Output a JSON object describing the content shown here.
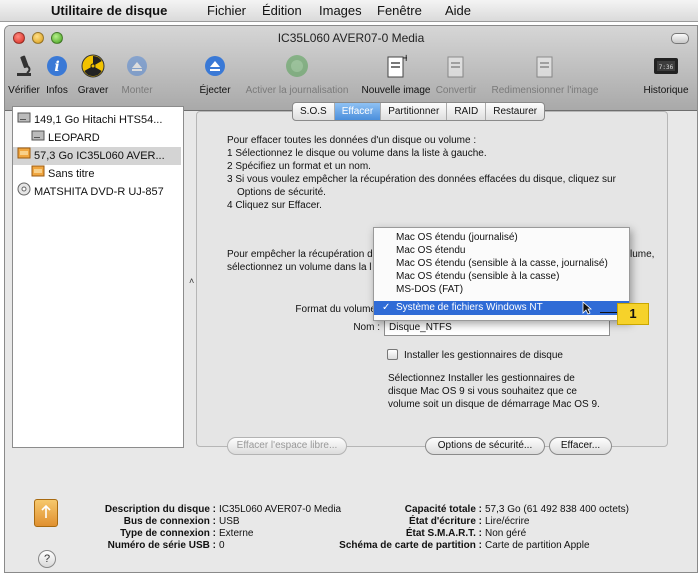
{
  "menubar": {
    "app_name": "Utilitaire de disque",
    "items": [
      "Fichier",
      "Édition",
      "Images",
      "Fenêtre",
      "Aide"
    ]
  },
  "window": {
    "title": "IC35L060 AVER07-0 Media"
  },
  "toolbar": {
    "items": [
      {
        "label": "Vérifier",
        "icon": "microscope-icon",
        "enabled": true
      },
      {
        "label": "Infos",
        "icon": "info-icon",
        "enabled": true
      },
      {
        "label": "Graver",
        "icon": "burn-icon",
        "enabled": true
      },
      {
        "label": "Monter",
        "icon": "mount-icon",
        "enabled": false
      },
      {
        "label": "Éjecter",
        "icon": "eject-icon",
        "enabled": true
      },
      {
        "label": "Activer la journalisation",
        "icon": "journal-icon",
        "enabled": false
      },
      {
        "label": "Nouvelle image",
        "icon": "new-image-icon",
        "enabled": true
      },
      {
        "label": "Convertir",
        "icon": "convert-icon",
        "enabled": false
      },
      {
        "label": "Redimensionner l'image",
        "icon": "resize-icon",
        "enabled": false
      },
      {
        "label": "Historique",
        "icon": "log-icon",
        "enabled": true
      }
    ]
  },
  "sidebar": {
    "items": [
      {
        "label": "149,1 Go Hitachi HTS54...",
        "icon": "hard-disk-icon",
        "selected": false
      },
      {
        "label": "LEOPARD",
        "icon": "volume-icon",
        "selected": false
      },
      {
        "label": "57,3 Go IC35L060 AVER...",
        "icon": "external-disk-icon",
        "selected": true
      },
      {
        "label": "Sans titre",
        "icon": "external-volume-icon",
        "selected": false
      },
      {
        "label": "MATSHITA DVD-R UJ-857",
        "icon": "optical-drive-icon",
        "selected": false
      }
    ]
  },
  "tabs": [
    "S.O.S",
    "Effacer",
    "Partitionner",
    "RAID",
    "Restaurer"
  ],
  "active_tab": "Effacer",
  "erase": {
    "instructions": [
      "Pour effacer toutes les données d'un disque ou volume :",
      "1 Sélectionnez le disque ou volume dans la liste à gauche.",
      "2 Spécifiez un format et un nom.",
      "3 Si vous voulez empêcher la récupération des données effacées du disque, cliquez sur",
      "Options de sécurité.",
      "4 Cliquez sur Effacer."
    ],
    "para2_line1_start": "Pour empêcher la récupération d",
    "para2_line1_end": "lume,",
    "para2_line2_start": "sélectionnez un volume dans la l",
    "format_label": "Format du volume",
    "name_label": "Nom :",
    "name_value": "Disque_NTFS",
    "install_drivers_label": "Installer les gestionnaires de disque",
    "drivers_help": [
      "Sélectionnez Installer les gestionnaires de",
      "disque Mac OS 9 si vous souhaitez que ce",
      "volume soit un disque de démarrage Mac OS 9."
    ],
    "erase_free_space_button": "Effacer l'espace libre...",
    "security_options_button": "Options de sécurité...",
    "erase_button": "Effacer..."
  },
  "format_menu": {
    "options": [
      "Mac OS étendu (journalisé)",
      "Mac OS étendu",
      "Mac OS étendu (sensible à la casse, journalisé)",
      "Mac OS étendu (sensible à la casse)",
      "MS-DOS (FAT)",
      "Système de fichiers Windows NT"
    ],
    "selected_index": 5,
    "check_mark": "✓"
  },
  "callout": "1",
  "info": {
    "left": [
      {
        "label": "Description du disque :",
        "value": "IC35L060 AVER07-0 Media"
      },
      {
        "label": "Bus de connexion :",
        "value": "USB"
      },
      {
        "label": "Type de connexion :",
        "value": "Externe"
      },
      {
        "label": "Numéro de série USB :",
        "value": "0"
      }
    ],
    "right": [
      {
        "label": "Capacité totale :",
        "value": "57,3 Go (61 492 838 400 octets)"
      },
      {
        "label": "État d'écriture :",
        "value": "Lire/écrire"
      },
      {
        "label": "État S.M.A.R.T. :",
        "value": "Non géré"
      },
      {
        "label": "Schéma de carte de partition :",
        "value": "Carte de partition Apple"
      }
    ]
  },
  "help_label": "?",
  "colors": {
    "selection_blue": "#2f6bd6",
    "tab_active": "#4b8fdc",
    "callout_yellow": "#f6d22a"
  }
}
